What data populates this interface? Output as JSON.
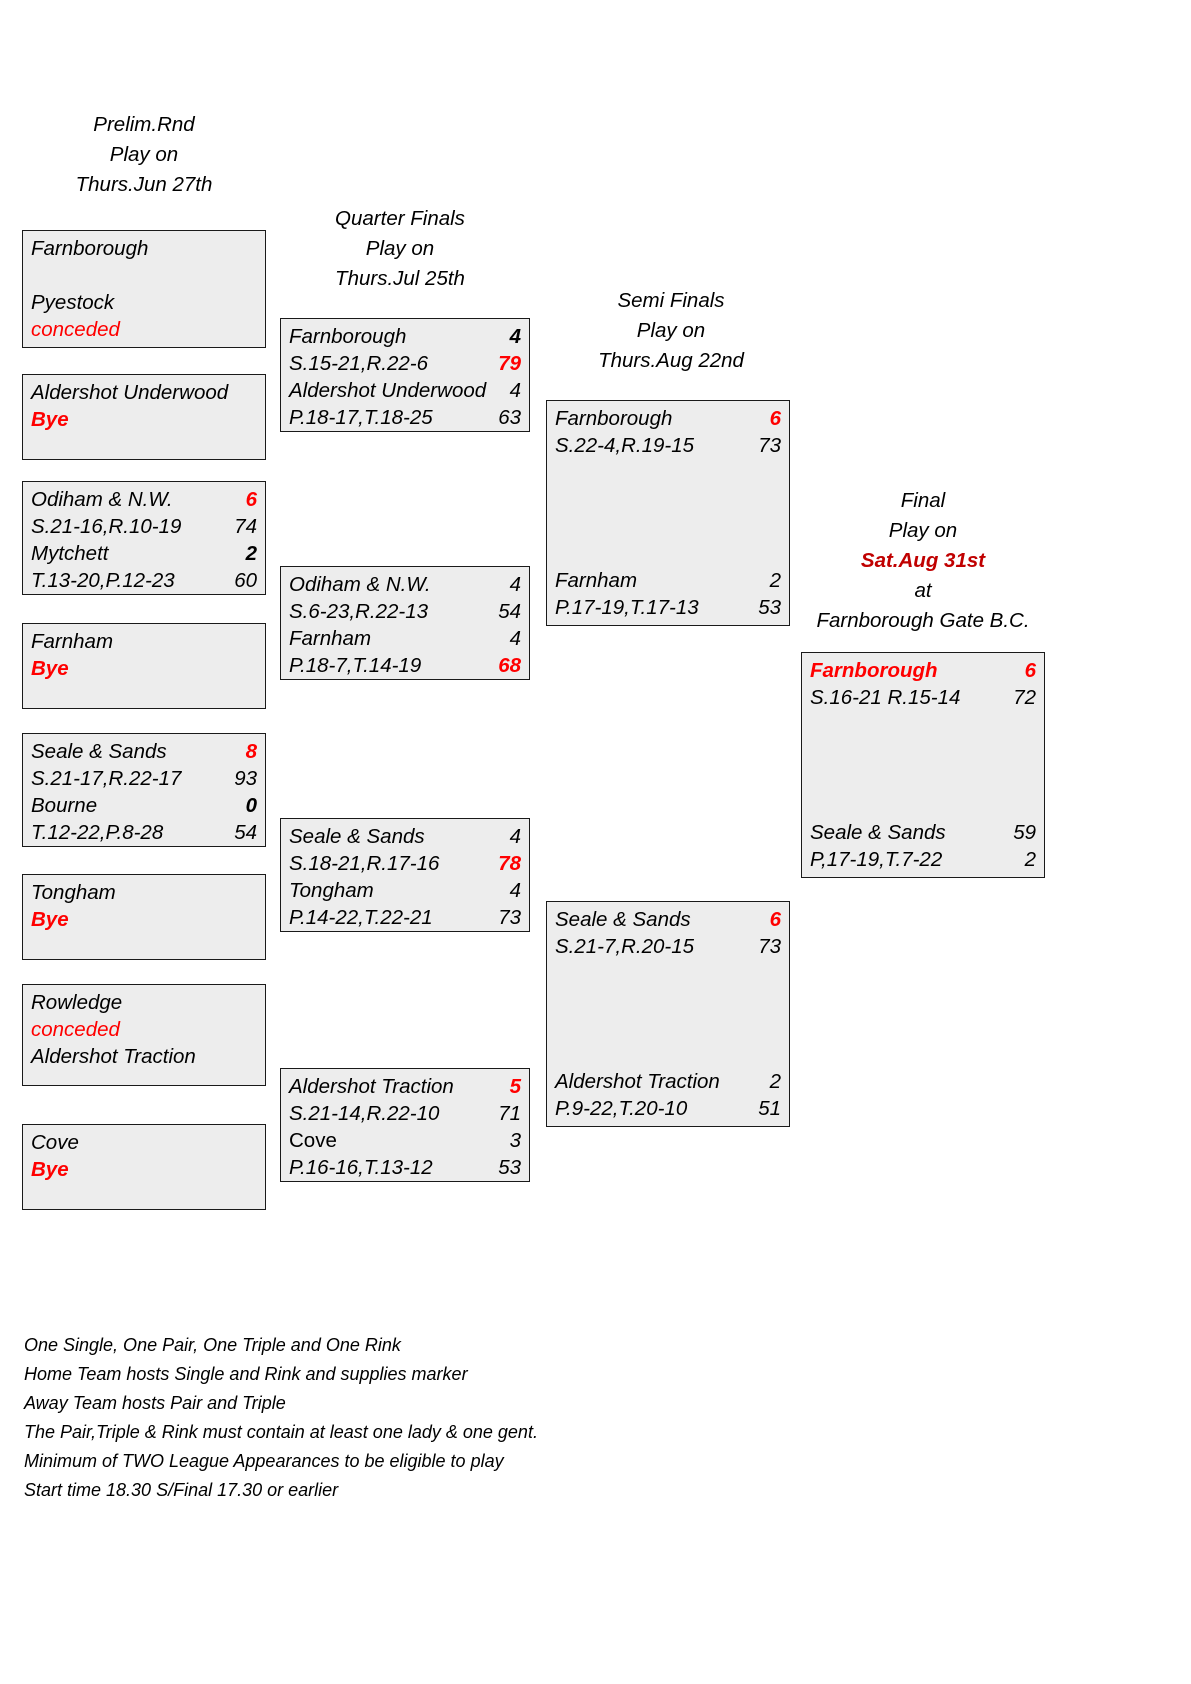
{
  "colors": {
    "red": "#FF0000",
    "dark_red": "#C00000",
    "box_fill": "#EDEDED",
    "box_border": "#1A1A1A"
  },
  "headers": {
    "prelim": {
      "line1": "Prelim.Rnd",
      "line2": "Play on",
      "line3": "Thurs.Jun 27th"
    },
    "quarter": {
      "line1": "Quarter Finals",
      "line2": "Play on",
      "line3": "Thurs.Jul 25th"
    },
    "semi": {
      "line1": "Semi Finals",
      "line2": "Play on",
      "line3": "Thurs.Aug 22nd"
    },
    "final": {
      "line1": "Final",
      "line2": "Play on",
      "line3": "Sat.Aug 31st",
      "line4": "at",
      "line5": "Farnborough Gate B.C."
    }
  },
  "prelim_round": {
    "match1": {
      "r1_name": "Farnborough",
      "r1_score": "",
      "r2_name": "",
      "r2_score": "",
      "r3_name": "Pyestock",
      "r3_score": "",
      "r4_name": "conceded",
      "r4_score": ""
    },
    "match2": {
      "r1_name": "Aldershot Underwood",
      "r1_score": "",
      "r2_name": "Bye",
      "r2_score": ""
    },
    "match3": {
      "r1_name": "Odiham & N.W.",
      "r1_score": "6",
      "r2_name": "S.21-16,R.10-19",
      "r2_score": "74",
      "r3_name": "Mytchett",
      "r3_score": "2",
      "r4_name": "T.13-20,P.12-23",
      "r4_score": "60"
    },
    "match4": {
      "r1_name": "Farnham",
      "r1_score": "",
      "r2_name": "Bye",
      "r2_score": ""
    },
    "match5": {
      "r1_name": "Seale & Sands",
      "r1_score": "8",
      "r2_name": "S.21-17,R.22-17",
      "r2_score": "93",
      "r3_name": "Bourne",
      "r3_score": "0",
      "r4_name": "T.12-22,P.8-28",
      "r4_score": "54"
    },
    "match6": {
      "r1_name": "Tongham",
      "r1_score": "",
      "r2_name": "Bye",
      "r2_score": ""
    },
    "match7": {
      "r1_name": "Rowledge",
      "r1_score": "",
      "r2_name": "conceded",
      "r2_score": "",
      "r3_name": "Aldershot Traction",
      "r3_score": ""
    },
    "match8": {
      "r1_name": "Cove",
      "r1_score": "",
      "r2_name": "Bye",
      "r2_score": ""
    }
  },
  "quarter_finals": {
    "match1": {
      "r1_name": "Farnborough",
      "r1_score": "4",
      "r2_name": "S.15-21,R.22-6",
      "r2_score": "79",
      "r3_name": "Aldershot Underwood",
      "r3_score": "4",
      "r4_name": "P.18-17,T.18-25",
      "r4_score": "63"
    },
    "match2": {
      "r1_name": "Odiham & N.W.",
      "r1_score": "4",
      "r2_name": "S.6-23,R.22-13",
      "r2_score": "54",
      "r3_name": "Farnham",
      "r3_score": "4",
      "r4_name": "P.18-7,T.14-19",
      "r4_score": "68"
    },
    "match3": {
      "r1_name": "Seale & Sands",
      "r1_score": "4",
      "r2_name": "S.18-21,R.17-16",
      "r2_score": "78",
      "r3_name": "Tongham",
      "r3_score": "4",
      "r4_name": "P.14-22,T.22-21",
      "r4_score": "73"
    },
    "match4": {
      "r1_name": "Aldershot Traction",
      "r1_score": "5",
      "r2_name": "S.21-14,R.22-10",
      "r2_score": "71",
      "r3_name": "Cove",
      "r3_score": "3",
      "r4_name": "P.16-16,T.13-12",
      "r4_score": "53"
    }
  },
  "semi_finals": {
    "match1": {
      "r1_name": "Farnborough",
      "r1_score": "6",
      "r2_name": "S.22-4,R.19-15",
      "r2_score": "73",
      "r3_name": "Farnham",
      "r3_score": "2",
      "r4_name": "P.17-19,T.17-13",
      "r4_score": "53"
    },
    "match2": {
      "r1_name": "Seale & Sands",
      "r1_score": "6",
      "r2_name": "S.21-7,R.20-15",
      "r2_score": "73",
      "r3_name": "Aldershot Traction",
      "r3_score": "2",
      "r4_name": "P.9-22,T.20-10",
      "r4_score": "51"
    }
  },
  "final_match": {
    "r1_name": "Farnborough",
    "r1_score": "6",
    "r2_name": "S.16-21 R.15-14",
    "r2_score": "72",
    "r3_name": "Seale & Sands",
    "r3_score": "59",
    "r4_name": "P,17-19,T.7-22",
    "r4_score": "2"
  },
  "notes": [
    "One Single, One Pair, One Triple and One Rink",
    "Home Team hosts Single and Rink and supplies marker",
    "Away Team hosts Pair and Triple",
    "The Pair,Triple & Rink must contain at least one lady & one gent.",
    "Minimum of TWO League Appearances to be eligible to play",
    "Start time 18.30 S/Final 17.30 or earlier"
  ]
}
